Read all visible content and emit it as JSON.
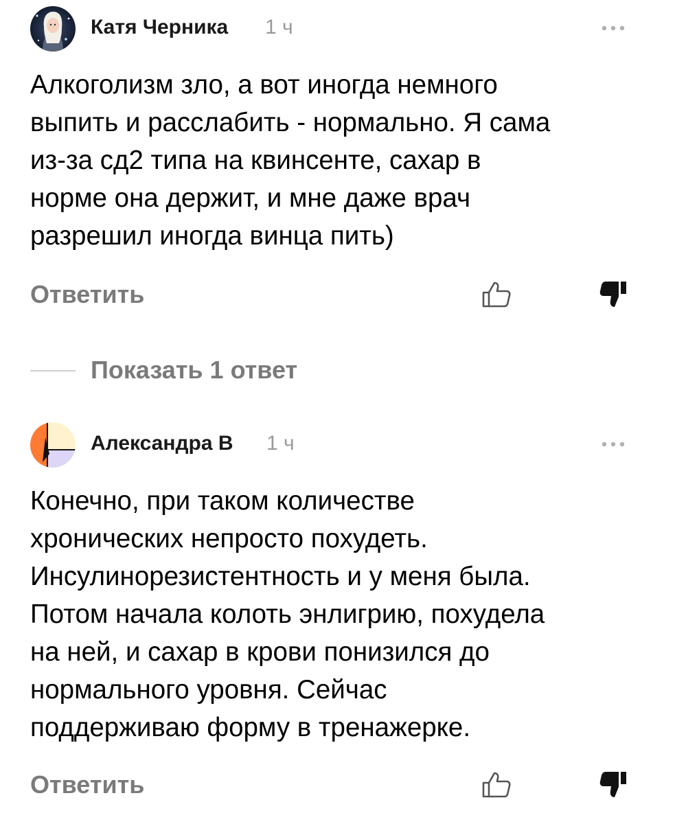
{
  "comments": [
    {
      "author": "Катя Черника",
      "time": "1 ч",
      "text": "Алкоголизм зло, а вот иногда немного\nвыпить и расслабить - нормально. Я сама\nиз-за сд2 типа на квинсенте, сахар в\nнорме она держит, и мне даже врач\nразрешил иногда винца пить)",
      "reply_label": "Ответить",
      "avatar_icon": "user-photo-avatar",
      "more_icon": "more-dots-icon",
      "like_icon": "thumb-up-outline-icon",
      "dislike_icon": "thumb-down-filled-icon"
    },
    {
      "author": "Александра В",
      "time": "1 ч",
      "text": "Конечно, при таком количестве\nхронических непросто похудеть.\nИнсулинорезистентность и у меня была.\nПотом начала колоть энлигрию, похудела\nна ней, и сахар в крови понизился до\nнормального уровня. Сейчас\nподдерживаю форму в тренажерке.",
      "reply_label": "Ответить",
      "avatar_icon": "geometric-avatar",
      "more_icon": "more-dots-icon",
      "like_icon": "thumb-up-outline-icon",
      "dislike_icon": "thumb-down-filled-icon"
    }
  ],
  "show_replies_label": "Показать 1 ответ",
  "colors": {
    "text": "#000000",
    "author": "#1a1a1a",
    "muted": "#7a7a7a",
    "time": "#9a9a9a",
    "divider": "#cfcfcf",
    "avatar2_orange": "#ff7a33",
    "avatar2_cream": "#fff3cf",
    "avatar2_lavender": "#ddd6f7"
  }
}
